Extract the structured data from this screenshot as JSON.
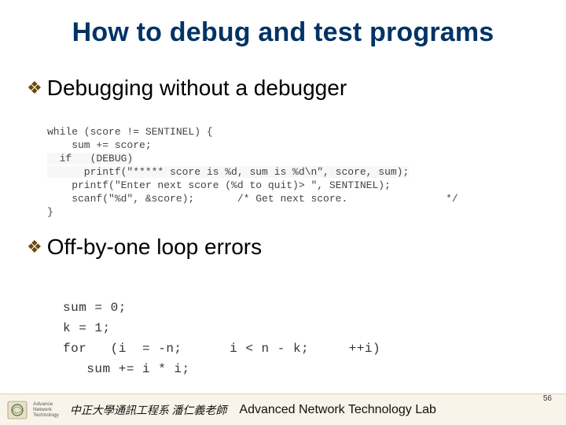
{
  "title": "How to debug and test programs",
  "bullets": {
    "b1": "Debugging without a debugger",
    "b2": "Off-by-one loop errors"
  },
  "code_block_1": {
    "l1": "while (score != SENTINEL) {",
    "l2": "    sum += score;",
    "l3_a": "  if   (DEBUG)",
    "l3_b": "      printf(\"***** score is %d, sum is %d\\n\", score, sum);",
    "l4": "    printf(\"Enter next score (%d to quit)> \", SENTINEL);",
    "l5": "    scanf(\"%d\", &score);       /* Get next score.                */",
    "l6": "}"
  },
  "code_block_2": {
    "l1": "sum = 0;",
    "l2": "k = 1;",
    "l3": "for   (i  = -n;      i < n - k;     ++i)",
    "l4": "   sum += i * i;"
  },
  "footer": {
    "logo_lines": "Advance\nNetwork\nTechnology",
    "cn": "中正大學通訊工程系 潘仁義老師",
    "en": "Advanced Network Technology Lab"
  },
  "page_number": "56"
}
